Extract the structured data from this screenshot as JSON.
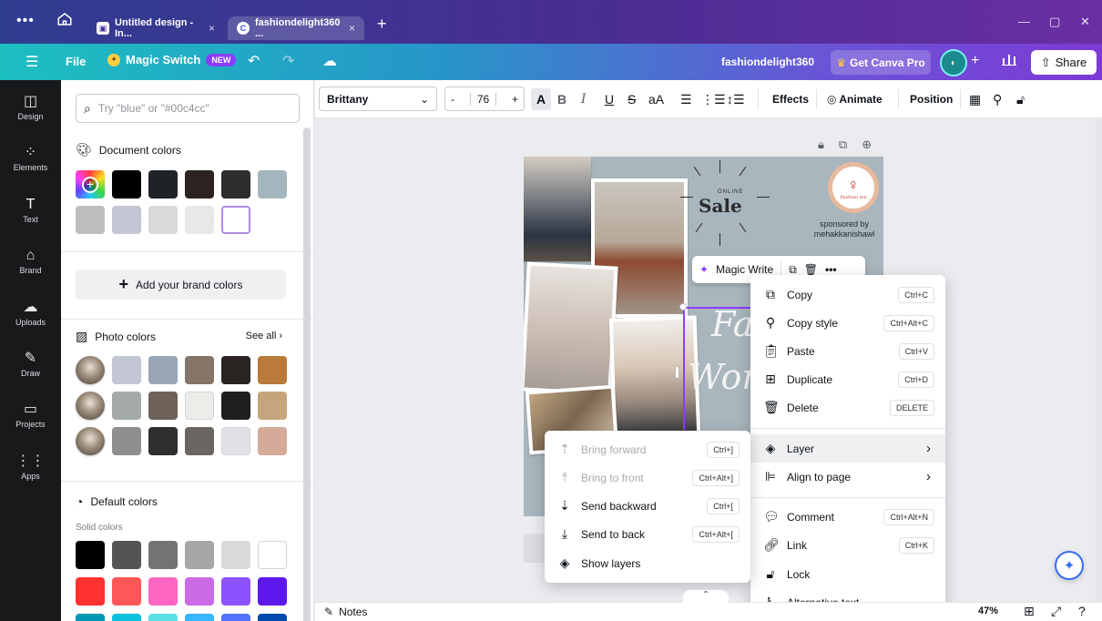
{
  "browser": {
    "tabs": [
      {
        "label": "Untitled design - In...",
        "icon": "chat-icon"
      },
      {
        "label": "fashiondelight360 ...",
        "icon": "canva-icon"
      }
    ],
    "new_tab": "+",
    "dots": "•••"
  },
  "appbar": {
    "file": "File",
    "magic_switch": "Magic Switch",
    "new_badge": "NEW",
    "project_name": "fashiondelight360",
    "get_pro": "Get Canva Pro",
    "share": "Share"
  },
  "rail": [
    {
      "label": "Design",
      "icon": "design-icon"
    },
    {
      "label": "Elements",
      "icon": "elements-icon"
    },
    {
      "label": "Text",
      "icon": "text-icon"
    },
    {
      "label": "Brand",
      "icon": "brand-icon"
    },
    {
      "label": "Uploads",
      "icon": "uploads-icon"
    },
    {
      "label": "Draw",
      "icon": "draw-icon"
    },
    {
      "label": "Projects",
      "icon": "projects-icon"
    },
    {
      "label": "Apps",
      "icon": "apps-icon"
    }
  ],
  "panel": {
    "search_placeholder": "Try \"blue\" or \"#00c4cc\"",
    "document_colors": {
      "title": "Document colors",
      "row1": [
        "#000000",
        "#1f2226",
        "#2c221f",
        "#2d2e30",
        "#a4b6bd"
      ],
      "row2": [
        "#bdbec0",
        "#c3c6d3",
        "#d9d9d9",
        "#e8e8e8",
        "#ffffff"
      ]
    },
    "add_brand_colors": "Add your brand colors",
    "photo_colors": {
      "title": "Photo colors",
      "see_all": "See all",
      "rows": [
        [
          "#c3c6d3",
          "#98a6b8",
          "#847568",
          "#2a2523",
          "#b97a3a"
        ],
        [
          "#a4aaa8",
          "#6d6158",
          "#ecece9",
          "#1f1f21",
          "#c7a57c"
        ],
        [
          "#8f8f8f",
          "#2f2f30",
          "#6b6661",
          "#e1e1e6",
          "#d4aa99"
        ]
      ]
    },
    "default_colors": {
      "title": "Default colors",
      "subtitle": "Solid colors",
      "row1": [
        "#000000",
        "#545454",
        "#737373",
        "#a6a6a6",
        "#d9d9d9",
        "#ffffff"
      ],
      "row2": [
        "#ff3131",
        "#ff5757",
        "#ff66c4",
        "#cb6ce6",
        "#8c52ff",
        "#5e17eb"
      ],
      "row3": [
        "#0097b2",
        "#0cc0df",
        "#5ce1e6",
        "#38b6ff",
        "#5271ff",
        "#004aad"
      ]
    }
  },
  "toolbar": {
    "font": "Brittany",
    "font_size": "76",
    "minus": "-",
    "plus": "+",
    "effects": "Effects",
    "animate": "Animate",
    "position": "Position"
  },
  "design": {
    "online": "ONLINE",
    "sale": "Sale",
    "sponsored": "sponsored by mehakkanishawl",
    "logo_text": "Fashion tee",
    "script1": "Fa",
    "script2": "Wom"
  },
  "magic_write": {
    "label": "Magic Write"
  },
  "context_menu": [
    {
      "label": "Copy",
      "shortcut": "Ctrl+C",
      "icon": "copy-icon"
    },
    {
      "label": "Copy style",
      "shortcut": "Ctrl+Alt+C",
      "icon": "paint-roller-icon"
    },
    {
      "label": "Paste",
      "shortcut": "Ctrl+V",
      "icon": "clipboard-icon"
    },
    {
      "label": "Duplicate",
      "shortcut": "Ctrl+D",
      "icon": "duplicate-icon"
    },
    {
      "label": "Delete",
      "shortcut": "DELETE",
      "icon": "trash-icon"
    },
    {
      "label": "Layer",
      "icon": "layers-icon"
    },
    {
      "label": "Align to page",
      "icon": "align-icon"
    },
    {
      "label": "Comment",
      "shortcut": "Ctrl+Alt+N",
      "icon": "comment-icon"
    },
    {
      "label": "Link",
      "shortcut": "Ctrl+K",
      "icon": "link-icon"
    },
    {
      "label": "Lock",
      "icon": "lock-icon"
    },
    {
      "label": "Alternative text",
      "icon": "accessibility-icon"
    }
  ],
  "layer_submenu": [
    {
      "label": "Bring forward",
      "shortcut": "Ctrl+]",
      "disabled": true
    },
    {
      "label": "Bring to front",
      "shortcut": "Ctrl+Alt+]",
      "disabled": true
    },
    {
      "label": "Send backward",
      "shortcut": "Ctrl+[",
      "disabled": false
    },
    {
      "label": "Send to back",
      "shortcut": "Ctrl+Alt+[",
      "disabled": false
    },
    {
      "label": "Show layers",
      "disabled": false
    }
  ],
  "bottombar": {
    "notes": "Notes",
    "zoom": "47%"
  },
  "colors": {
    "accent": "#8b3dff",
    "rail_bg": "#18191b"
  }
}
